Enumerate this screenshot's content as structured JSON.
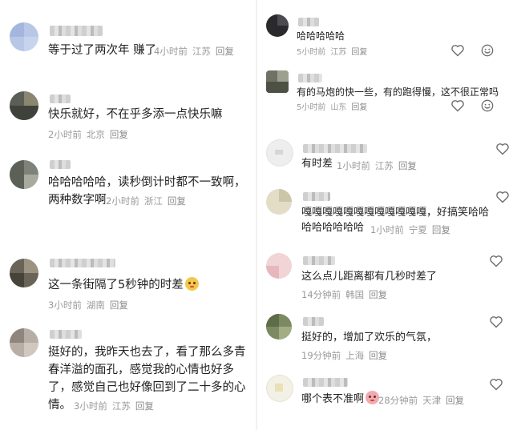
{
  "left": [
    {
      "text": [
        "等于过了两次年 赚了"
      ],
      "time": "4小时前",
      "region": "江苏",
      "reply": "回复"
    },
    {
      "text": [
        "快乐就好，不在乎多添一点快乐嘛"
      ],
      "time": "2小时前",
      "region": "北京",
      "reply": "回复"
    },
    {
      "text": [
        "哈哈哈哈哈，读秒倒计时都不一致啊，",
        "两种数字啊"
      ],
      "time": "2小时前",
      "region": "浙江",
      "reply": "回复"
    },
    {
      "text": [
        "这一条街隔了5秒钟的时差"
      ],
      "time": "3小时前",
      "region": "湖南",
      "reply": "回复"
    },
    {
      "text": [
        "挺好的，我昨天也去了，看了那么多青",
        "春洋溢的面孔，感觉我的心情也好多",
        "了，感觉自己也好像回到了二十多的心",
        "情。"
      ],
      "time": "3小时前",
      "region": "江苏",
      "reply": "回复"
    }
  ],
  "right": [
    {
      "text": [
        "哈哈哈哈哈"
      ],
      "time": "5小时前",
      "region": "江苏",
      "reply": "回复"
    },
    {
      "text": [
        "有的马炮的快一些，有的跑得慢，这不很正常吗"
      ],
      "time": "5小时前",
      "region": "山东",
      "reply": "回复"
    },
    {
      "text": [
        "有时差"
      ],
      "time": "1小时前",
      "region": "江苏",
      "reply": "回复"
    },
    {
      "text": [
        "嘎嘎嘎嘎嘎嘎嘎嘎嘎嘎嘎嘎，好搞笑哈哈",
        "哈哈哈哈哈哈"
      ],
      "time": "1小时前",
      "region": "宁夏",
      "reply": "回复"
    },
    {
      "text": [
        "这么点儿距离都有几秒时差了"
      ],
      "time": "14分钟前",
      "region": "韩国",
      "reply": "回复"
    },
    {
      "text": [
        "挺好的，增加了欢乐的气氛，"
      ],
      "time": "19分钟前",
      "region": "上海",
      "reply": "回复"
    },
    {
      "text": [
        "哪个表不准啊"
      ],
      "time": "28分钟前",
      "region": "天津",
      "reply": "回复"
    }
  ],
  "icons": {
    "like": "heart-outline-icon",
    "react": "smile-emoji-icon",
    "inline_emoji": "laughing-emoji-icon",
    "pig_emoji": "pig-emoji-icon"
  }
}
